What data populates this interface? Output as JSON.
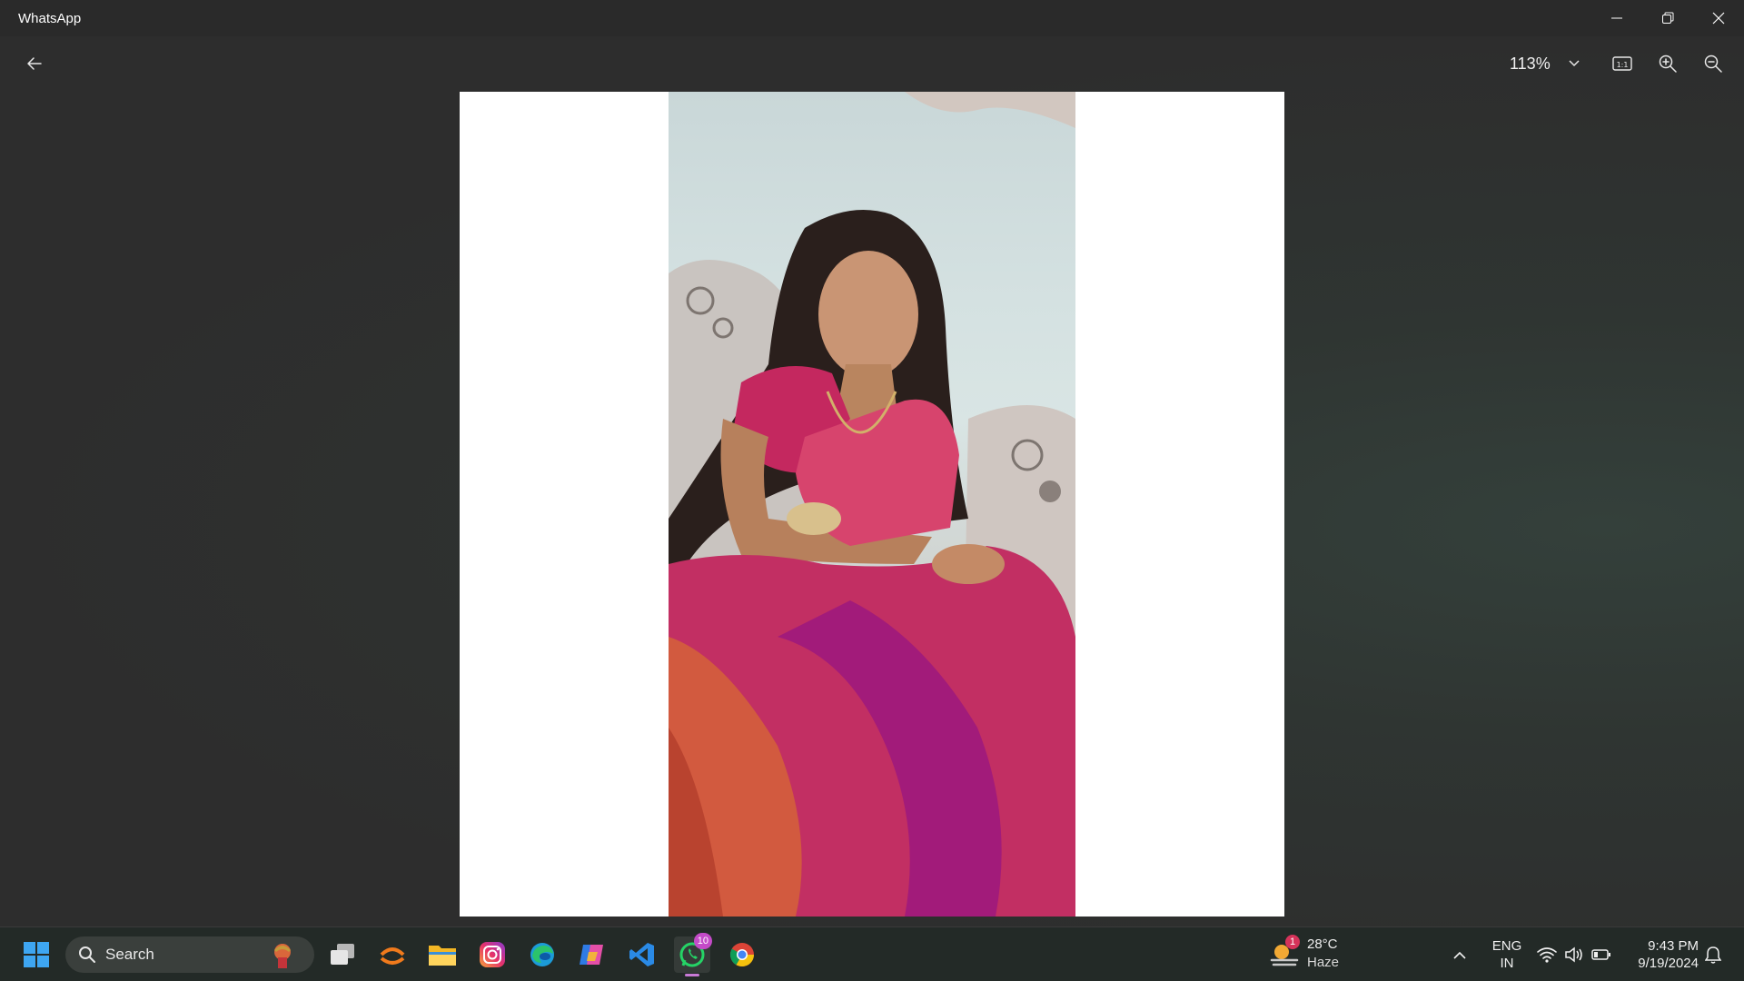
{
  "window": {
    "title": "WhatsApp"
  },
  "viewer": {
    "zoom_level": "113%",
    "buttons": {
      "back": "back-arrow-icon",
      "zoom_dropdown": "chevron-down-icon",
      "actual_size": "actual-size-icon",
      "zoom_in": "zoom-in-icon",
      "zoom_out": "zoom-out-icon"
    }
  },
  "taskbar": {
    "search_label": "Search",
    "apps": [
      {
        "name": "start-icon"
      },
      {
        "name": "task-view-icon"
      },
      {
        "name": "app-orange-arc-icon"
      },
      {
        "name": "file-explorer-icon"
      },
      {
        "name": "instagram-icon"
      },
      {
        "name": "edge-icon"
      },
      {
        "name": "copilot-icon"
      },
      {
        "name": "vscode-icon"
      },
      {
        "name": "whatsapp-icon",
        "badge": "10",
        "active": true
      },
      {
        "name": "chrome-icon"
      }
    ],
    "weather": {
      "badge": "1",
      "temperature": "28°C",
      "condition": "Haze"
    },
    "language": {
      "line1": "ENG",
      "line2": "IN"
    },
    "clock": {
      "time": "9:43 PM",
      "date": "9/19/2024"
    },
    "colors": {
      "taskbar_bg": "#232a27",
      "whatsapp_green": "#25d366",
      "badge": "#c44bc8"
    }
  }
}
